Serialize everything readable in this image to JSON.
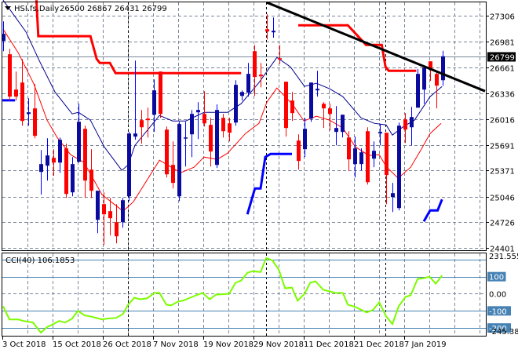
{
  "header": {
    "symbol_label": "HSI.fs,Daily",
    "ohlc_label": "26500 26867 26431 26799",
    "menu_icon": "triangle-down-icon"
  },
  "current_price_label": "26799",
  "cci_label": "CCI(40) 106.1853",
  "colors": {
    "bull_body": "#0a0a9e",
    "bull_wick": "#0000ff",
    "bear": "#ff0000",
    "grid": "#7a8699",
    "cci": "#7cfc00",
    "levels": "#4682b4",
    "trendline": "#000000"
  },
  "chart_data": [
    {
      "type": "candlestick",
      "title": "HSI.fs,Daily",
      "ylim": [
        24366,
        27502
      ],
      "y_ticks": [
        "27306",
        "26981",
        "26661",
        "26336",
        "26016",
        "25691",
        "25371",
        "25046",
        "24726",
        "24401"
      ],
      "y_tick_values": [
        27306,
        26981,
        26661,
        26336,
        26016,
        25691,
        25371,
        25046,
        24726,
        24401
      ],
      "current_price": 26799,
      "x_tick_labels": [
        {
          "bar": 0,
          "label": "3 Oct 2018"
        },
        {
          "bar": 8,
          "label": "15 Oct 2018"
        },
        {
          "bar": 16,
          "label": "26 Oct 2018"
        },
        {
          "bar": 24,
          "label": "7 Nov 2018"
        },
        {
          "bar": 32,
          "label": "19 Nov 2018"
        },
        {
          "bar": 40,
          "label": "29 Nov 2018"
        },
        {
          "bar": 48,
          "label": "11 Dec 2018"
        },
        {
          "bar": 56,
          "label": "21 Dec 2018"
        },
        {
          "bar": 64,
          "label": "7 Jan 2019"
        }
      ],
      "period_separators": [
        20,
        42,
        61
      ],
      "ohlc": [
        [
          26990,
          27235,
          26863,
          27079
        ],
        [
          26824,
          26892,
          26246,
          26295
        ],
        [
          26383,
          26608,
          26246,
          26295
        ],
        [
          26471,
          26765,
          25932,
          25991
        ],
        [
          26079,
          26275,
          25932,
          26099
        ],
        [
          26148,
          26451,
          25775,
          25805
        ],
        [
          25354,
          25628,
          25070,
          25452
        ],
        [
          25432,
          25775,
          25246,
          25560
        ],
        [
          25530,
          25638,
          25305,
          25471
        ],
        [
          25471,
          25785,
          25344,
          25756
        ],
        [
          25648,
          25707,
          25030,
          25079
        ],
        [
          25099,
          25540,
          25050,
          25452
        ],
        [
          25481,
          26206,
          25471,
          25981
        ],
        [
          25893,
          25932,
          25030,
          25246
        ],
        [
          25383,
          25638,
          25030,
          25119
        ],
        [
          24756,
          25119,
          24589,
          25119
        ],
        [
          24952,
          25099,
          24442,
          24825
        ],
        [
          24864,
          25030,
          24560,
          24776
        ],
        [
          24727,
          24952,
          24462,
          24550
        ],
        [
          24727,
          25030,
          24658,
          25001
        ],
        [
          25050,
          25854,
          24991,
          25834
        ],
        [
          25795,
          26745,
          25756,
          25834
        ],
        [
          26001,
          26128,
          25707,
          25912
        ],
        [
          26020,
          26157,
          25785,
          26001
        ],
        [
          26069,
          26510,
          25854,
          26373
        ],
        [
          26608,
          26608,
          26030,
          26079
        ],
        [
          25883,
          25922,
          25285,
          25324
        ],
        [
          25442,
          25736,
          25148,
          25217
        ],
        [
          25050,
          25981,
          24991,
          25952
        ],
        [
          25775,
          25981,
          25422,
          25785
        ],
        [
          25824,
          26128,
          25540,
          26079
        ],
        [
          26099,
          26226,
          25765,
          26128
        ],
        [
          26079,
          26363,
          25922,
          25961
        ],
        [
          25942,
          26030,
          25422,
          25609
        ],
        [
          25442,
          26197,
          25403,
          26128
        ],
        [
          26030,
          26079,
          25785,
          25863
        ],
        [
          25961,
          26030,
          25736,
          25844
        ],
        [
          25971,
          26500,
          25932,
          26442
        ],
        [
          26304,
          26373,
          26246,
          26353
        ],
        [
          26344,
          26716,
          26295,
          26579
        ],
        [
          26863,
          26941,
          26304,
          26540
        ],
        [
          26569,
          26716,
          26412,
          26549
        ],
        [
          27137,
          27324,
          27010,
          27108
        ],
        [
          27098,
          27284,
          27030,
          27118
        ],
        [
          26775,
          26941,
          26706,
          26765
        ],
        [
          26481,
          26481,
          25795,
          25903
        ],
        [
          26246,
          26353,
          25991,
          26089
        ],
        [
          25746,
          25824,
          25383,
          25491
        ],
        [
          25638,
          26030,
          25540,
          25893
        ],
        [
          26020,
          26471,
          25981,
          26471
        ],
        [
          26373,
          26618,
          26295,
          26393
        ],
        [
          26206,
          26226,
          25903,
          26148
        ],
        [
          26148,
          26206,
          25873,
          26079
        ],
        [
          25854,
          26177,
          25687,
          25903
        ],
        [
          25854,
          26069,
          25785,
          26069
        ],
        [
          25785,
          25863,
          25364,
          25511
        ],
        [
          25452,
          25795,
          25285,
          25648
        ],
        [
          25452,
          25648,
          25373,
          25599
        ],
        [
          25863,
          25912,
          25197,
          25226
        ],
        [
          25520,
          25736,
          25413,
          25618
        ],
        [
          25834,
          25952,
          25687,
          25854
        ],
        [
          25844,
          25844,
          24952,
          25315
        ],
        [
          25040,
          25217,
          24854,
          25089
        ],
        [
          24903,
          25971,
          24874,
          25932
        ],
        [
          26010,
          26089,
          25716,
          25883
        ],
        [
          25912,
          26167,
          25687,
          26040
        ],
        [
          26157,
          26638,
          26157,
          26579
        ],
        [
          26383,
          26657,
          26206,
          26657
        ],
        [
          26736,
          26736,
          26491,
          26638
        ],
        [
          26579,
          26598,
          26148,
          26432
        ],
        [
          26500,
          26867,
          26431,
          26799
        ]
      ],
      "overlays": {
        "ma_fast": [
          [
            0,
            27500
          ],
          [
            3.6,
            27108
          ],
          [
            5.75,
            26745
          ],
          [
            8.25,
            26353
          ],
          [
            11,
            26079
          ],
          [
            12,
            26099
          ],
          [
            13.9,
            26001
          ],
          [
            16.1,
            25667
          ],
          [
            18.9,
            25373
          ],
          [
            19.9,
            25442
          ],
          [
            21,
            25687
          ],
          [
            24.9,
            26059
          ],
          [
            27,
            25991
          ],
          [
            29.1,
            25991
          ],
          [
            32,
            26099
          ],
          [
            35.75,
            26099
          ],
          [
            37.9,
            26206
          ],
          [
            40.75,
            26471
          ],
          [
            43.6,
            26785
          ],
          [
            45.75,
            26667
          ],
          [
            48,
            26422
          ],
          [
            49.9,
            26461
          ],
          [
            52,
            26393
          ],
          [
            54.1,
            26295
          ],
          [
            57,
            26030
          ],
          [
            59.1,
            25961
          ],
          [
            61,
            25942
          ],
          [
            62,
            25814
          ],
          [
            63.6,
            25912
          ],
          [
            65.5,
            26001
          ],
          [
            68,
            26295
          ],
          [
            69.9,
            26422
          ]
        ],
        "ma_slow": [
          [
            0,
            27137
          ],
          [
            2.4,
            26843
          ],
          [
            4.9,
            26451
          ],
          [
            7,
            26001
          ],
          [
            8.6,
            25785
          ],
          [
            10.75,
            25569
          ],
          [
            12.9,
            25471
          ],
          [
            15.75,
            25070
          ],
          [
            19.1,
            24864
          ],
          [
            20.75,
            24981
          ],
          [
            24.9,
            25501
          ],
          [
            28.25,
            25344
          ],
          [
            30.4,
            25413
          ],
          [
            32,
            25540
          ],
          [
            34.1,
            25511
          ],
          [
            35.75,
            25589
          ],
          [
            38.6,
            25834
          ],
          [
            40.75,
            25961
          ],
          [
            42,
            26226
          ],
          [
            43.6,
            26402
          ],
          [
            46.1,
            26197
          ],
          [
            47.9,
            25991
          ],
          [
            49.9,
            26050
          ],
          [
            52,
            26001
          ],
          [
            54.1,
            25903
          ],
          [
            56.1,
            25667
          ],
          [
            58.25,
            25560
          ],
          [
            59.9,
            25569
          ],
          [
            61,
            25422
          ],
          [
            62.9,
            25275
          ],
          [
            64.9,
            25413
          ],
          [
            66.6,
            25638
          ],
          [
            68,
            25834
          ],
          [
            69.75,
            25961
          ]
        ],
        "resistance_steps": [
          [
            [
              5.3,
              27500
            ],
            [
              5.6,
              27050
            ],
            [
              13.9,
              27050
            ],
            [
              14.9,
              26765
            ],
            [
              15.4,
              26716
            ],
            [
              17,
              26716
            ],
            [
              17.9,
              26589
            ],
            [
              37.9,
              26589
            ]
          ],
          [
            [
              47,
              27186
            ],
            [
              54.9,
              27186
            ],
            [
              57.8,
              26941
            ],
            [
              60.3,
              26941
            ],
            [
              60.9,
              26667
            ],
            [
              61.4,
              26618
            ],
            [
              65.8,
              26618
            ]
          ]
        ],
        "support_steps": [
          [
            [
              -0.1,
              26249
            ],
            [
              1.9,
              26249
            ]
          ],
          [
            [
              38.9,
              24825
            ],
            [
              40.1,
              25148
            ],
            [
              41,
              25148
            ],
            [
              41.75,
              25540
            ],
            [
              42.6,
              25579
            ],
            [
              46,
              25579
            ]
          ],
          [
            [
              67,
              24736
            ],
            [
              68,
              24874
            ],
            [
              69.2,
              24874
            ],
            [
              69.9,
              25011
            ]
          ]
        ],
        "trendline": [
          [
            42,
            27471
          ],
          [
            76.75,
            26363
          ]
        ]
      }
    },
    {
      "type": "line",
      "title": "CCI(40)",
      "value_label": "106.1853",
      "ylim": [
        -245.384,
        231.5552
      ],
      "levels": [
        200,
        100,
        -100,
        -200
      ],
      "zero_level": 0,
      "axis_labels": {
        "top": "231.5552",
        "l100": "100",
        "zero": "0.00",
        "lm100": "-100",
        "lm200": "-200",
        "bottom": "-245.384"
      },
      "points": [
        [
          0,
          -73
        ],
        [
          1,
          -150
        ],
        [
          2.4,
          -150
        ],
        [
          3.25,
          -159
        ],
        [
          4.75,
          -168
        ],
        [
          6,
          -227
        ],
        [
          7,
          -195
        ],
        [
          8,
          -177
        ],
        [
          8.9,
          -159
        ],
        [
          9.9,
          -168
        ],
        [
          11,
          -145
        ],
        [
          11.9,
          -100
        ],
        [
          13,
          -127
        ],
        [
          13.9,
          -132
        ],
        [
          15.75,
          -150
        ],
        [
          16.6,
          -145
        ],
        [
          18,
          -141
        ],
        [
          19.1,
          -118
        ],
        [
          19.9,
          -64
        ],
        [
          20.9,
          -23
        ],
        [
          21.75,
          -32
        ],
        [
          22.9,
          -27
        ],
        [
          24.1,
          5
        ],
        [
          24.9,
          5
        ],
        [
          26,
          -64
        ],
        [
          26.75,
          -68
        ],
        [
          27.9,
          -45
        ],
        [
          28.6,
          -41
        ],
        [
          30.4,
          -14
        ],
        [
          31.75,
          5
        ],
        [
          32.9,
          -32
        ],
        [
          33.9,
          -5
        ],
        [
          36,
          0
        ],
        [
          37,
          64
        ],
        [
          37.9,
          77
        ],
        [
          38.9,
          123
        ],
        [
          39.75,
          132
        ],
        [
          41,
          127
        ],
        [
          41.9,
          209
        ],
        [
          42.9,
          195
        ],
        [
          43.9,
          141
        ],
        [
          44.9,
          32
        ],
        [
          46,
          36
        ],
        [
          46.9,
          -41
        ],
        [
          48,
          0
        ],
        [
          48.9,
          64
        ],
        [
          49.75,
          73
        ],
        [
          51,
          23
        ],
        [
          52,
          14
        ],
        [
          52.9,
          5
        ],
        [
          54.1,
          5
        ],
        [
          54.9,
          -64
        ],
        [
          56.1,
          -77
        ],
        [
          57.9,
          -109
        ],
        [
          58.9,
          -95
        ],
        [
          59.9,
          -50
        ],
        [
          61,
          -132
        ],
        [
          62,
          -177
        ],
        [
          63,
          -73
        ],
        [
          64.1,
          -18
        ],
        [
          64.9,
          -9
        ],
        [
          66,
          86
        ],
        [
          67,
          91
        ],
        [
          67.9,
          100
        ],
        [
          68.9,
          59
        ],
        [
          69.9,
          106.19
        ]
      ]
    }
  ]
}
